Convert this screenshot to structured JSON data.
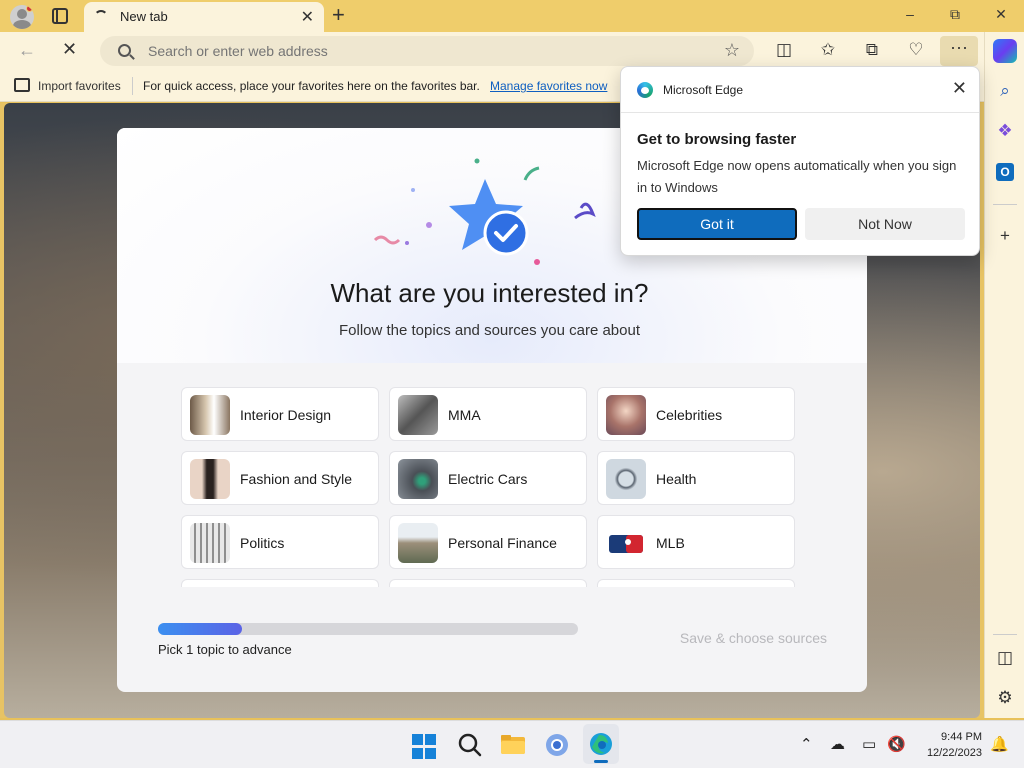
{
  "window": {
    "tab_title": "New tab",
    "new_tab_symbol": "+",
    "controls": {
      "minimize": "–",
      "restore": "⧉",
      "close": "✕"
    }
  },
  "toolbar": {
    "back_symbol": "←",
    "stop_symbol": "✕",
    "address_placeholder": "Search or enter web address",
    "more_symbol": "···"
  },
  "favorites_bar": {
    "import_label": "Import favorites",
    "hint_text": "For quick access, place your favorites here on the favorites bar.",
    "manage_link": "Manage favorites now"
  },
  "onboarding": {
    "title": "What are you interested in?",
    "subtitle": "Follow the topics and sources you care about",
    "topics": [
      {
        "label": "Interior Design"
      },
      {
        "label": "MMA"
      },
      {
        "label": "Celebrities"
      },
      {
        "label": "Fashion and Style"
      },
      {
        "label": "Electric Cars"
      },
      {
        "label": "Health"
      },
      {
        "label": "Politics"
      },
      {
        "label": "Personal Finance"
      },
      {
        "label": "MLB"
      }
    ],
    "progress_fraction": 0.2,
    "progress_text": "Pick 1 topic to advance",
    "save_label": "Save & choose sources"
  },
  "popup": {
    "app_name": "Microsoft Edge",
    "title": "Get to browsing faster",
    "body": "Microsoft Edge now opens automatically when you sign in to Windows",
    "primary_button": "Got it",
    "secondary_button": "Not Now"
  },
  "taskbar": {
    "time": "9:44 PM",
    "date": "12/22/2023"
  },
  "colors": {
    "accent": "#0f6cbd",
    "titlebar": "#efcd6b",
    "toolbar": "#fbf3dc"
  }
}
